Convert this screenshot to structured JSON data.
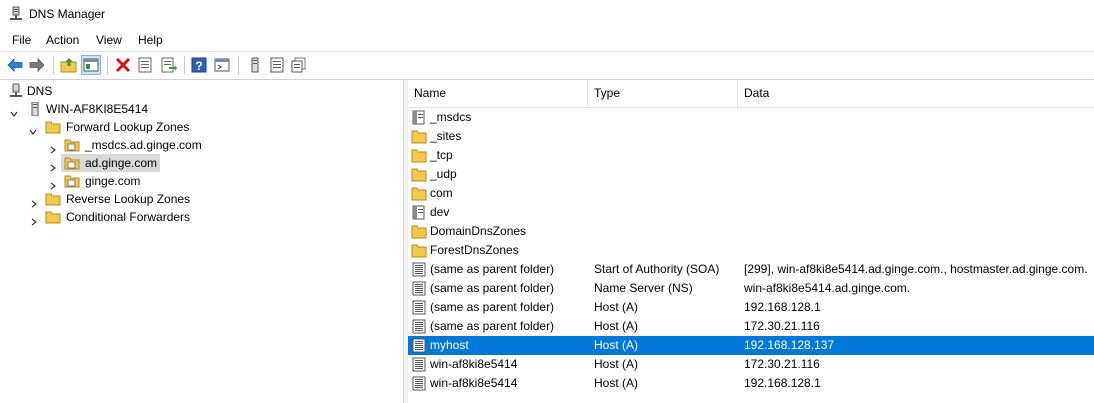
{
  "window": {
    "title": "DNS Manager"
  },
  "menu": [
    "File",
    "Action",
    "View",
    "Help"
  ],
  "toolbar": {
    "buttons": [
      "back-icon",
      "forward-icon",
      "up-folder-icon",
      "show-hide-tree-icon",
      "delete-icon",
      "properties-icon",
      "export-list-icon",
      "help-icon",
      "console-icon",
      "server-icon",
      "list-icon",
      "copy-icon"
    ]
  },
  "tree": {
    "root": "DNS",
    "server": "WIN-AF8KI8E5414",
    "forward": "Forward Lookup Zones",
    "zones": [
      "_msdcs.ad.ginge.com",
      "ad.ginge.com",
      "ginge.com"
    ],
    "selected_zone": "ad.ginge.com",
    "reverse": "Reverse Lookup Zones",
    "conditional": "Conditional Forwarders"
  },
  "list": {
    "columns": [
      "Name",
      "Type",
      "Data"
    ],
    "rows": [
      {
        "name": "_msdcs",
        "type": "",
        "data": "",
        "icon": "delegated-folder"
      },
      {
        "name": "_sites",
        "type": "",
        "data": "",
        "icon": "folder"
      },
      {
        "name": "_tcp",
        "type": "",
        "data": "",
        "icon": "folder"
      },
      {
        "name": "_udp",
        "type": "",
        "data": "",
        "icon": "folder"
      },
      {
        "name": "com",
        "type": "",
        "data": "",
        "icon": "folder"
      },
      {
        "name": "dev",
        "type": "",
        "data": "",
        "icon": "delegated-folder"
      },
      {
        "name": "DomainDnsZones",
        "type": "",
        "data": "",
        "icon": "folder"
      },
      {
        "name": "ForestDnsZones",
        "type": "",
        "data": "",
        "icon": "folder"
      },
      {
        "name": "(same as parent folder)",
        "type": "Start of Authority (SOA)",
        "data": "[299], win-af8ki8e5414.ad.ginge.com., hostmaster.ad.ginge.com.",
        "icon": "record"
      },
      {
        "name": "(same as parent folder)",
        "type": "Name Server (NS)",
        "data": "win-af8ki8e5414.ad.ginge.com.",
        "icon": "record"
      },
      {
        "name": "(same as parent folder)",
        "type": "Host (A)",
        "data": "192.168.128.1",
        "icon": "record"
      },
      {
        "name": "(same as parent folder)",
        "type": "Host (A)",
        "data": "172.30.21.116",
        "icon": "record"
      },
      {
        "name": "myhost",
        "type": "Host (A)",
        "data": "192.168.128.137",
        "icon": "record",
        "selected": true
      },
      {
        "name": "win-af8ki8e5414",
        "type": "Host (A)",
        "data": "172.30.21.116",
        "icon": "record"
      },
      {
        "name": "win-af8ki8e5414",
        "type": "Host (A)",
        "data": "192.168.128.1",
        "icon": "record"
      }
    ]
  },
  "colors": {
    "selection": "#0078d7",
    "folder": "#f2c94c",
    "tree_selection": "#d9d9d9"
  }
}
